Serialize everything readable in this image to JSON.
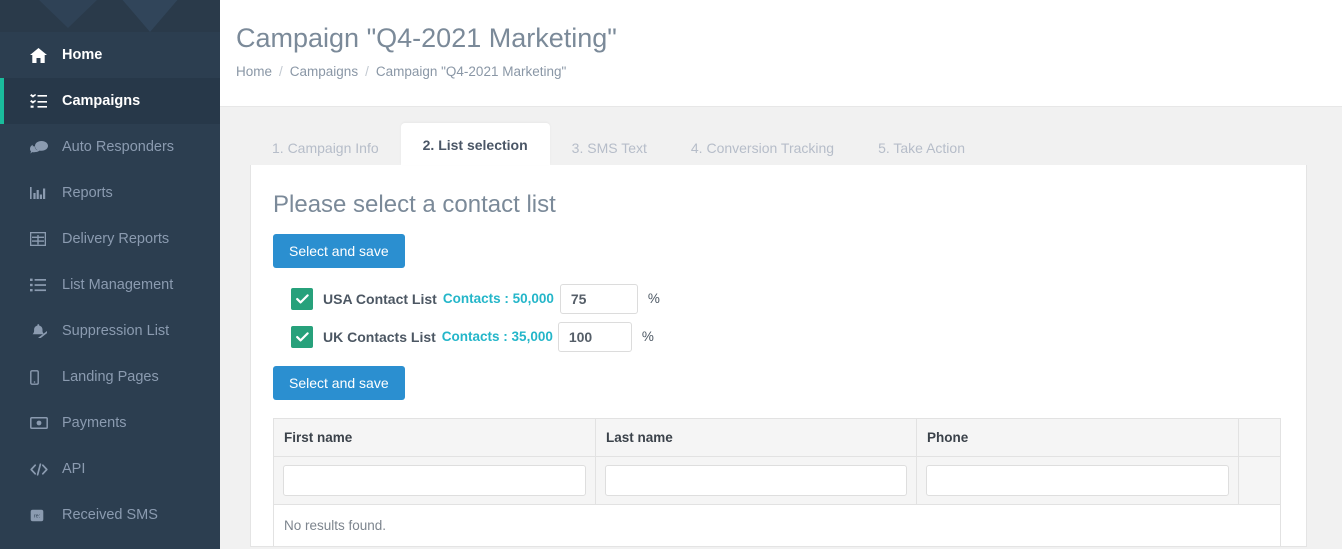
{
  "sidebar": {
    "items": [
      {
        "label": "Home",
        "icon": "home-icon",
        "state": "plain"
      },
      {
        "label": "Campaigns",
        "icon": "tasks-icon",
        "state": "active"
      },
      {
        "label": "Auto Responders",
        "icon": "comments-icon",
        "state": "normal"
      },
      {
        "label": "Reports",
        "icon": "bar-chart-icon",
        "state": "normal"
      },
      {
        "label": "Delivery Reports",
        "icon": "table-icon",
        "state": "normal"
      },
      {
        "label": "List Management",
        "icon": "list-icon",
        "state": "normal"
      },
      {
        "label": "Suppression List",
        "icon": "ban-bell-slash-icon",
        "state": "normal"
      },
      {
        "label": "Landing Pages",
        "icon": "mobile-icon",
        "state": "normal"
      },
      {
        "label": "Payments",
        "icon": "money-icon",
        "state": "normal"
      },
      {
        "label": "API",
        "icon": "code-icon",
        "state": "normal"
      },
      {
        "label": "Received SMS",
        "icon": "inbox-sms-icon",
        "state": "normal"
      }
    ]
  },
  "header": {
    "title": "Campaign \"Q4-2021 Marketing\"",
    "breadcrumb": [
      "Home",
      "Campaigns",
      "Campaign \"Q4-2021 Marketing\""
    ],
    "separator": "/"
  },
  "tabs": [
    {
      "label": "1. Campaign Info",
      "active": false
    },
    {
      "label": "2. List selection",
      "active": true
    },
    {
      "label": "3. SMS Text",
      "active": false
    },
    {
      "label": "4. Conversion Tracking",
      "active": false
    },
    {
      "label": "5. Take Action",
      "active": false
    }
  ],
  "panel": {
    "title": "Please select a contact list",
    "save_top_label": "Select and save",
    "save_bottom_label": "Select and save",
    "percent_symbol": "%",
    "lists": [
      {
        "name": "USA Contact List",
        "count_label": "Contacts : 50,000",
        "percent": "75",
        "checked": true
      },
      {
        "name": "UK Contacts List",
        "count_label": "Contacts : 35,000",
        "percent": "100",
        "checked": true
      }
    ],
    "table": {
      "columns": [
        "First name",
        "Last name",
        "Phone",
        ""
      ],
      "filters": [
        "",
        "",
        ""
      ],
      "empty_message": "No results found."
    }
  },
  "colors": {
    "sidebar_bg": "#2c3e50",
    "sidebar_active_bg": "#273849",
    "sidebar_accent": "#1abc9c",
    "primary_button": "#2b8fd0",
    "checkbox_green": "#27a17b",
    "count_teal": "#24b6c9",
    "content_bg": "#f1f1f1"
  }
}
